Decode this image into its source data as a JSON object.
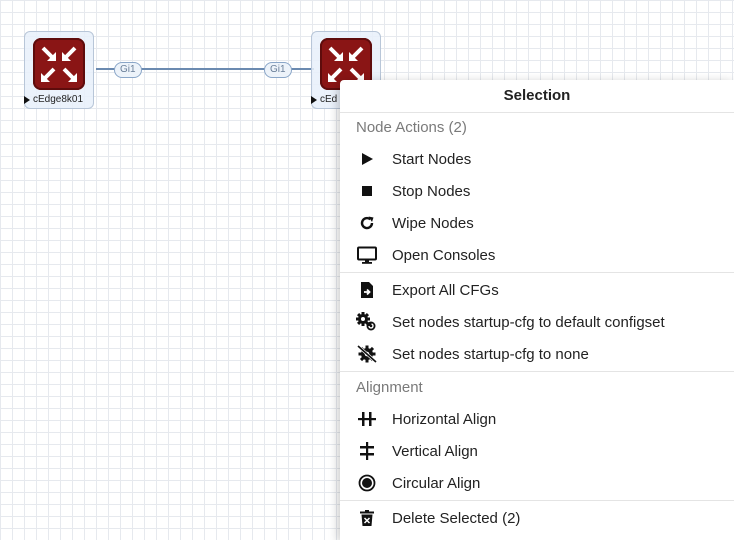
{
  "canvas": {
    "nodes": [
      {
        "label": "cEdge8k01"
      },
      {
        "label": "cEd"
      }
    ],
    "link": {
      "iface_a": "Gi1",
      "iface_b": "Gi1"
    }
  },
  "menu": {
    "title": "Selection",
    "sections": {
      "node_actions": "Node Actions (2)",
      "alignment": "Alignment"
    },
    "items": {
      "start_nodes": "Start Nodes",
      "stop_nodes": "Stop Nodes",
      "wipe_nodes": "Wipe Nodes",
      "open_consoles": "Open Consoles",
      "export_cfgs": "Export All CFGs",
      "startup_default": "Set nodes startup-cfg to default configset",
      "startup_none": "Set nodes startup-cfg to none",
      "horizontal_align": "Horizontal Align",
      "vertical_align": "Vertical Align",
      "circular_align": "Circular Align",
      "delete_selected": "Delete Selected (2)"
    }
  },
  "colors": {
    "router": "#8a1515",
    "link": "#6b8ab0"
  },
  "icons": [
    "play-icon",
    "stop-icon",
    "wipe-icon",
    "console-icon",
    "export-icon",
    "gear-default-icon",
    "gear-none-icon",
    "horizontal-align-icon",
    "vertical-align-icon",
    "circular-align-icon",
    "trash-icon"
  ]
}
